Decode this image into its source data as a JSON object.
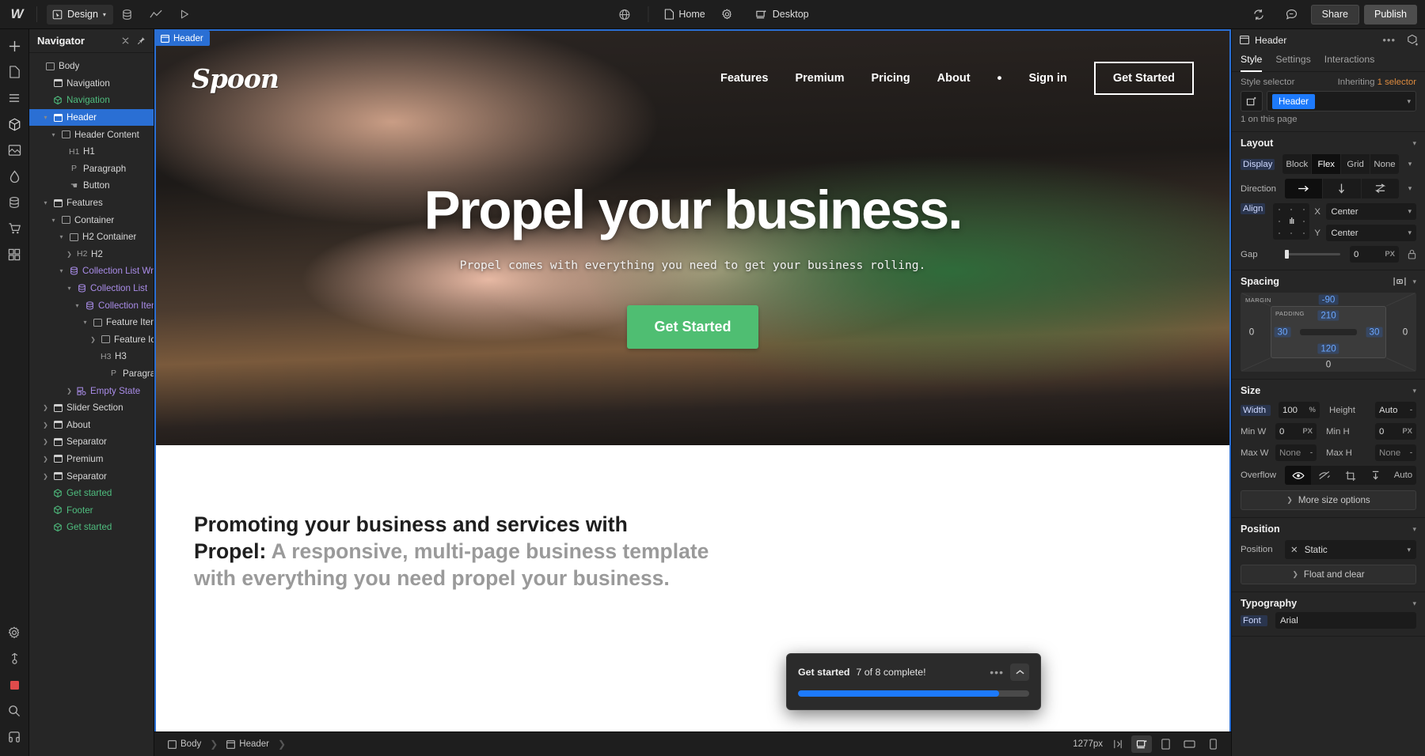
{
  "topbar": {
    "logo": "webflow-logo",
    "mode_label": "Design",
    "icons": [
      "cursor-box-icon",
      "chevron-down-icon",
      "database-icon",
      "analytics-icon",
      "play-icon",
      "globe-icon"
    ],
    "page_chip": "Home",
    "page_settings_icon": "gear-icon",
    "breakpoint_chip": "Desktop",
    "sync_icon": "sync-icon",
    "comment_icon": "comment-icon",
    "share_label": "Share",
    "publish_label": "Publish"
  },
  "toolbar": {
    "items": [
      {
        "name": "add-elements",
        "icon": "plus-icon"
      },
      {
        "name": "pages",
        "icon": "page-icon"
      },
      {
        "name": "navigator",
        "icon": "layers-icon"
      },
      {
        "name": "components",
        "icon": "cube-icon"
      },
      {
        "name": "assets",
        "icon": "image-icon"
      },
      {
        "name": "variables",
        "icon": "droplet-icon"
      },
      {
        "name": "cms",
        "icon": "cms-icon"
      },
      {
        "name": "ecommerce",
        "icon": "cart-icon"
      },
      {
        "name": "apps",
        "icon": "grid-icon"
      }
    ],
    "bottom_items": [
      {
        "name": "settings",
        "icon": "gear-icon"
      },
      {
        "name": "audit",
        "icon": "audit-icon"
      },
      {
        "name": "record",
        "icon": "record-icon"
      },
      {
        "name": "search",
        "icon": "search-icon"
      },
      {
        "name": "help",
        "icon": "help-icon"
      }
    ]
  },
  "navigator": {
    "title": "Navigator",
    "close_icon": "collapse-icon",
    "pin_icon": "pin-icon",
    "items": [
      {
        "label": "Body",
        "depth": 0,
        "type": "box",
        "caret": "",
        "selected": false
      },
      {
        "label": "Navigation",
        "depth": 1,
        "type": "sect",
        "caret": "",
        "selected": false
      },
      {
        "label": "Navigation",
        "depth": 1,
        "type": "comp",
        "caret": "",
        "selected": false
      },
      {
        "label": "Header",
        "depth": 1,
        "type": "sect",
        "caret": "v",
        "selected": true
      },
      {
        "label": "Header Content",
        "depth": 2,
        "type": "box",
        "caret": "v",
        "selected": false
      },
      {
        "label": "H1",
        "depth": 3,
        "type": "tag",
        "tag": "H1",
        "caret": "",
        "selected": false
      },
      {
        "label": "Paragraph",
        "depth": 3,
        "type": "tag",
        "tag": "P",
        "caret": "",
        "selected": false
      },
      {
        "label": "Button",
        "depth": 3,
        "type": "tag",
        "tag": "☚",
        "caret": "",
        "selected": false
      },
      {
        "label": "Features",
        "depth": 1,
        "type": "sect",
        "caret": "v",
        "selected": false
      },
      {
        "label": "Container",
        "depth": 2,
        "type": "box",
        "caret": "v",
        "selected": false
      },
      {
        "label": "H2 Container",
        "depth": 3,
        "type": "box",
        "caret": "v",
        "selected": false
      },
      {
        "label": "H2",
        "depth": 4,
        "type": "tag",
        "tag": "H2",
        "caret": ">",
        "selected": false
      },
      {
        "label": "Collection List Wrap",
        "depth": 3,
        "type": "cms",
        "caret": "v",
        "selected": false
      },
      {
        "label": "Collection List",
        "depth": 4,
        "type": "cms",
        "caret": "v",
        "selected": false
      },
      {
        "label": "Collection Item",
        "depth": 5,
        "type": "cms",
        "caret": "v",
        "selected": false
      },
      {
        "label": "Feature Item",
        "depth": 6,
        "type": "box",
        "caret": "v",
        "selected": false
      },
      {
        "label": "Feature Icon",
        "depth": 7,
        "type": "box",
        "caret": ">",
        "selected": false
      },
      {
        "label": "H3",
        "depth": 7,
        "type": "tag",
        "tag": "H3",
        "caret": "",
        "selected": false
      },
      {
        "label": "Paragraph",
        "depth": 8,
        "type": "tag",
        "tag": "P",
        "caret": "",
        "selected": false
      },
      {
        "label": "Empty State",
        "depth": 4,
        "type": "empty",
        "caret": ">",
        "selected": false
      },
      {
        "label": "Slider Section",
        "depth": 1,
        "type": "sect",
        "caret": ">",
        "selected": false
      },
      {
        "label": "About",
        "depth": 1,
        "type": "sect",
        "caret": ">",
        "selected": false
      },
      {
        "label": "Separator",
        "depth": 1,
        "type": "sect",
        "caret": ">",
        "selected": false
      },
      {
        "label": "Premium",
        "depth": 1,
        "type": "sect",
        "caret": ">",
        "selected": false
      },
      {
        "label": "Separator",
        "depth": 1,
        "type": "sect",
        "caret": ">",
        "selected": false
      },
      {
        "label": "Get started",
        "depth": 1,
        "type": "comp",
        "caret": "",
        "selected": false
      },
      {
        "label": "Footer",
        "depth": 1,
        "type": "comp",
        "caret": "",
        "selected": false
      },
      {
        "label": "Get started",
        "depth": 1,
        "type": "comp",
        "caret": "",
        "selected": false
      }
    ]
  },
  "canvas": {
    "element_badge": "Header",
    "brand": "Spoon",
    "nav_links": [
      "Features",
      "Premium",
      "Pricing",
      "About",
      "•",
      "Sign in"
    ],
    "nav_button": "Get Started",
    "headline": "Propel your business.",
    "subhead": "Propel comes with everything you need to get your business rolling.",
    "cta": "Get Started",
    "below_line1_strong": "Promoting your business and services with",
    "below_line2_strong": "Propel:",
    "below_line2_rest": " A responsive, multi-page business template",
    "below_line3": "with everything you need propel your business."
  },
  "get_started_panel": {
    "title": "Get started",
    "progress_text": "7 of 8 complete!",
    "progress_percent": 87,
    "more_icon": "ellipsis-icon",
    "collapse_icon": "chevron-up-icon"
  },
  "statusbar": {
    "breadcrumbs": [
      "Body",
      "Header"
    ],
    "viewport_size": "1277px",
    "resize_icon": "resize-handle-icon",
    "devices": [
      "desktop-icon",
      "tablet-icon",
      "mobile-landscape-icon",
      "mobile-portrait-icon"
    ]
  },
  "style_panel": {
    "element_name": "Header",
    "more_icon": "ellipsis-icon",
    "component_icon": "create-component-icon",
    "tabs": [
      "Style",
      "Settings",
      "Interactions"
    ],
    "active_tab": "Style",
    "selector": {
      "label": "Style selector",
      "inherit_prefix": "Inheriting",
      "inherit_count": "1 selector",
      "chip": "Header",
      "state_icon": "selector-state-icon",
      "chevron": "chevron-down-icon",
      "usage": "1 on this page"
    },
    "layout": {
      "title": "Layout",
      "display_label": "Display",
      "display_options": [
        "Block",
        "Flex",
        "Grid",
        "None"
      ],
      "display_active": "Flex",
      "direction_label": "Direction",
      "direction_options": [
        "horizontal-arrow-icon",
        "vertical-arrow-icon",
        "wrap-arrow-icon"
      ],
      "direction_active": 0,
      "align_label": "Align",
      "align_x_label": "X",
      "align_x_value": "Center",
      "align_y_label": "Y",
      "align_y_value": "Center",
      "gap_label": "Gap",
      "gap_value": "0",
      "gap_unit": "PX",
      "gap_lock_icon": "lock-icon"
    },
    "spacing": {
      "title": "Spacing",
      "edit_icon": "spacing-edit-icon",
      "margin_label": "MARGIN",
      "padding_label": "PADDING",
      "margin_top": "-90",
      "margin_right": "0",
      "margin_bottom": "0",
      "margin_left": "0",
      "padding_top": "210",
      "padding_right": "30",
      "padding_bottom": "120",
      "padding_left": "30"
    },
    "size": {
      "title": "Size",
      "width_label": "Width",
      "width_value": "100",
      "width_unit": "%",
      "height_label": "Height",
      "height_value": "Auto",
      "minw_label": "Min W",
      "minw_value": "0",
      "minw_unit": "PX",
      "minh_label": "Min H",
      "minh_value": "0",
      "minh_unit": "PX",
      "maxw_label": "Max W",
      "maxw_value": "None",
      "maxh_label": "Max H",
      "maxh_value": "None",
      "overflow_label": "Overflow",
      "overflow_options": [
        "eye-icon",
        "eye-off-icon",
        "crop-icon",
        "scroll-icon",
        "Auto"
      ],
      "overflow_active": 0,
      "more_options": "More size options"
    },
    "position": {
      "title": "Position",
      "position_label": "Position",
      "position_value": "Static",
      "clear_icon": "close-icon",
      "float_clear": "Float and clear"
    },
    "typography": {
      "title": "Typography",
      "font_label": "Font",
      "font_value": "Arial"
    }
  }
}
